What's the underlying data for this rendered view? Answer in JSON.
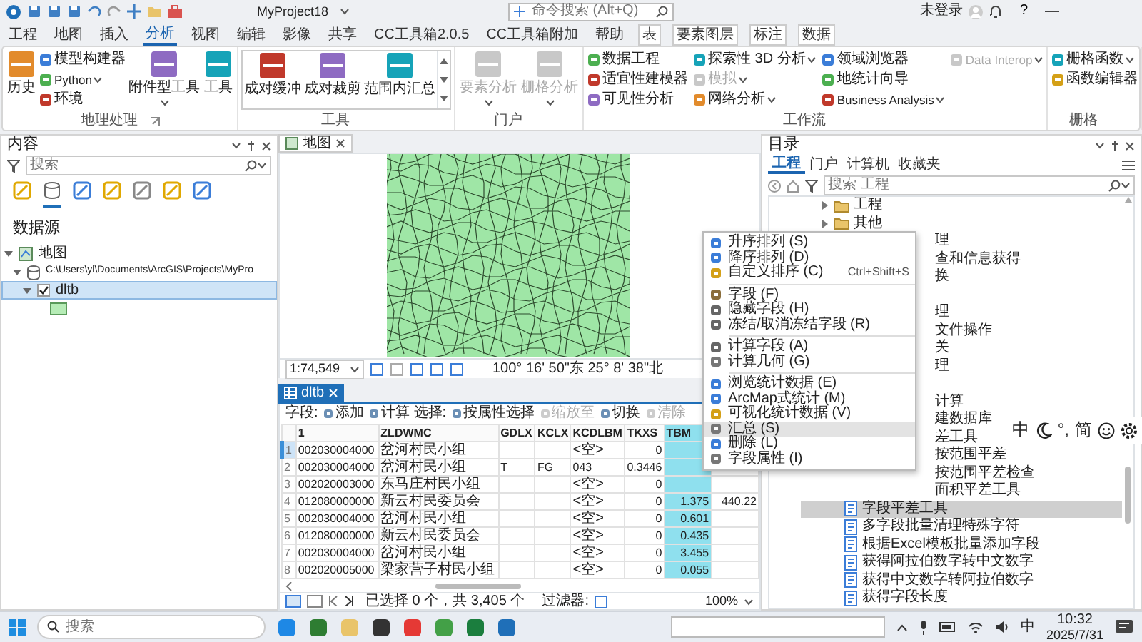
{
  "title_bar": {
    "project": "MyProject18",
    "search": {
      "placeholder": "命令搜索 (Alt+Q)"
    },
    "user": "未登录",
    "help": "?"
  },
  "ribbon_tabs": [
    {
      "label": "工程",
      "selected": false,
      "contextual": false
    },
    {
      "label": "地图",
      "selected": false,
      "contextual": false
    },
    {
      "label": "插入",
      "selected": false,
      "contextual": false
    },
    {
      "label": "分析",
      "selected": true,
      "contextual": false
    },
    {
      "label": "视图",
      "selected": false,
      "contextual": false
    },
    {
      "label": "编辑",
      "selected": false,
      "contextual": false
    },
    {
      "label": "影像",
      "selected": false,
      "contextual": false
    },
    {
      "label": "共享",
      "selected": false,
      "contextual": false
    },
    {
      "label": "CC工具箱2.0.5",
      "selected": false,
      "contextual": false
    },
    {
      "label": "CC工具箱附加",
      "selected": false,
      "contextual": false
    },
    {
      "label": "帮助",
      "selected": false,
      "contextual": false
    },
    {
      "label": "表",
      "selected": false,
      "contextual": true
    },
    {
      "label": "要素图层",
      "selected": false,
      "contextual": true
    },
    {
      "label": "标注",
      "selected": false,
      "contextual": true
    },
    {
      "label": "数据",
      "selected": false,
      "contextual": true
    }
  ],
  "ribbon_groups": [
    {
      "label": "地理处理",
      "launcher": true,
      "items": [
        {
          "label": "历史",
          "kind": "large",
          "dropdown": false,
          "disabled": false
        },
        {
          "label": "模型构建器",
          "kind": "small",
          "dropdown": false,
          "disabled": false
        },
        {
          "label": "Python",
          "kind": "small",
          "dropdown": true,
          "disabled": false
        },
        {
          "label": "环境",
          "kind": "small",
          "dropdown": false,
          "disabled": false
        },
        {
          "label": "附件型工具",
          "kind": "large",
          "dropdown": true,
          "disabled": false
        },
        {
          "label": "工具",
          "kind": "large",
          "dropdown": false,
          "disabled": false
        }
      ]
    },
    {
      "label": "工具",
      "launcher": false,
      "items": [
        {
          "label": "成对缓冲",
          "kind": "gallery",
          "dropdown": false,
          "disabled": false
        },
        {
          "label": "成对裁剪",
          "kind": "gallery",
          "dropdown": false,
          "disabled": false
        },
        {
          "label": "范围内汇总",
          "kind": "gallery",
          "dropdown": false,
          "disabled": false
        }
      ]
    },
    {
      "label": "门户",
      "launcher": false,
      "items": [
        {
          "label": "要素分析",
          "kind": "large",
          "dropdown": true,
          "disabled": true
        },
        {
          "label": "栅格分析",
          "kind": "large",
          "dropdown": true,
          "disabled": true
        }
      ]
    },
    {
      "label": "工作流",
      "launcher": false,
      "items": [
        {
          "label": "数据工程",
          "kind": "small",
          "dropdown": false,
          "disabled": false
        },
        {
          "label": "适宜性建模器",
          "kind": "small",
          "dropdown": false,
          "disabled": false
        },
        {
          "label": "可见性分析",
          "kind": "small",
          "dropdown": false,
          "disabled": false
        },
        {
          "label": "探索性 3D 分析",
          "kind": "small",
          "dropdown": true,
          "disabled": false
        },
        {
          "label": "模拟",
          "kind": "small",
          "dropdown": true,
          "disabled": true
        },
        {
          "label": "网络分析",
          "kind": "small",
          "dropdown": true,
          "disabled": false
        },
        {
          "label": "领域浏览器",
          "kind": "small",
          "dropdown": false,
          "disabled": false
        },
        {
          "label": "地统计向导",
          "kind": "small",
          "dropdown": false,
          "disabled": false
        },
        {
          "label": "Business Analysis",
          "kind": "small",
          "dropdown": true,
          "disabled": false
        },
        {
          "label": "Data Interop",
          "kind": "small",
          "dropdown": true,
          "disabled": true
        }
      ]
    },
    {
      "label": "栅格",
      "launcher": false,
      "items": [
        {
          "label": "栅格函数",
          "kind": "small",
          "dropdown": true,
          "disabled": false
        },
        {
          "label": "函数编辑器",
          "kind": "small",
          "dropdown": false,
          "disabled": false
        }
      ]
    }
  ],
  "contents_pane": {
    "title": "内容",
    "search": {
      "placeholder": "搜索"
    },
    "toolbar": [
      {
        "selected": false
      },
      {
        "selected": true
      },
      {
        "selected": false
      },
      {
        "selected": false
      },
      {
        "selected": false
      },
      {
        "selected": false
      },
      {
        "selected": false
      }
    ],
    "heading": "数据源",
    "tree": [
      {
        "label": "地图",
        "kind": "map",
        "expanded": true,
        "selected": false,
        "children": [
          {
            "label": "C:\\Users\\yl\\Documents\\ArcGIS\\Projects\\MyPro—",
            "kind": "database",
            "expanded": true,
            "selected": false,
            "children": [
              {
                "label": "dltb",
                "expanded": true,
                "checked": true,
                "selected": true,
                "children": [
                  {
                    "kind": "symbol"
                  }
                ]
              }
            ]
          }
        ]
      }
    ]
  },
  "map_view": {
    "tab": "地图",
    "scale": "1:74,549",
    "coordinates": "100° 16' 50\"东 25° 8' 38\"北"
  },
  "table_view": {
    "tab": "dltb",
    "toolbar": [
      {
        "label": "字段:",
        "kind": "label"
      },
      {
        "label": "添加",
        "kind": "button",
        "disabled": false
      },
      {
        "label": "计算",
        "kind": "button",
        "disabled": false
      },
      {
        "label": "选择:",
        "kind": "label"
      },
      {
        "label": "按属性选择",
        "kind": "button",
        "disabled": false
      },
      {
        "label": "缩放至",
        "kind": "button",
        "disabled": true
      },
      {
        "label": "切换",
        "kind": "button",
        "disabled": false
      },
      {
        "label": "清除",
        "kind": "button",
        "disabled": true
      }
    ],
    "columns": [
      {
        "label": "1",
        "selected": false
      },
      {
        "label": "ZLDWMC",
        "selected": false
      },
      {
        "label": "GDLX",
        "selected": false
      },
      {
        "label": "KCLX",
        "selected": false
      },
      {
        "label": "KCDLBM",
        "selected": false
      },
      {
        "label": "TKXS",
        "selected": false
      },
      {
        "label": "TBM",
        "selected": true
      }
    ],
    "rows": [
      {
        "number": "1",
        "selected": true,
        "cells": [
          "002030004000",
          "岔河村民小组",
          null,
          null,
          "<空>",
          "0",
          null,
          null
        ]
      },
      {
        "number": "2",
        "selected": false,
        "cells": [
          "002030004000",
          "岔河村民小组",
          "T",
          "FG",
          "043",
          "0.3446",
          null,
          null
        ]
      },
      {
        "number": "3",
        "selected": false,
        "cells": [
          "002020003000",
          "东马庄村民小组",
          null,
          null,
          "<空>",
          "0",
          null,
          null
        ]
      },
      {
        "number": "4",
        "selected": false,
        "cells": [
          "012080000000",
          "新云村民委员会",
          null,
          null,
          "<空>",
          "0",
          "1.375",
          "440.22"
        ]
      },
      {
        "number": "5",
        "selected": false,
        "cells": [
          "002030004000",
          "岔河村民小组",
          null,
          null,
          "<空>",
          "0",
          "0.601",
          null
        ]
      },
      {
        "number": "6",
        "selected": false,
        "cells": [
          "012080000000",
          "新云村民委员会",
          null,
          null,
          "<空>",
          "0",
          "0.435",
          null
        ]
      },
      {
        "number": "7",
        "selected": false,
        "cells": [
          "002030004000",
          "岔河村民小组",
          null,
          null,
          "<空>",
          "0",
          "3.455",
          null
        ]
      },
      {
        "number": "8",
        "selected": false,
        "cells": [
          "002020005000",
          "梁家营子村民小组",
          null,
          null,
          "<空>",
          "0",
          "0.055",
          null
        ]
      }
    ],
    "status": "已选择 0 个，共 3,405 个",
    "filter_label": "过滤器:",
    "zoom": "100%"
  },
  "context_menu": [
    {
      "kind": "item",
      "label": "升序排列 (S)",
      "highlighted": false
    },
    {
      "kind": "item",
      "label": "降序排列 (D)",
      "highlighted": false
    },
    {
      "kind": "item",
      "label": "自定义排序 (C)",
      "shortcut": "Ctrl+Shift+S",
      "highlighted": false
    },
    {
      "kind": "separator"
    },
    {
      "kind": "item",
      "label": "字段 (F)",
      "highlighted": false
    },
    {
      "kind": "item",
      "label": "隐藏字段 (H)",
      "highlighted": false
    },
    {
      "kind": "item",
      "label": "冻结/取消冻结字段 (R)",
      "highlighted": false
    },
    {
      "kind": "separator"
    },
    {
      "kind": "item",
      "label": "计算字段 (A)",
      "highlighted": false
    },
    {
      "kind": "item",
      "label": "计算几何 (G)",
      "highlighted": false
    },
    {
      "kind": "separator"
    },
    {
      "kind": "item",
      "label": "浏览统计数据 (E)",
      "highlighted": false
    },
    {
      "kind": "item",
      "label": "ArcMap式统计 (M)",
      "highlighted": false
    },
    {
      "kind": "item",
      "label": "可视化统计数据 (V)",
      "highlighted": false
    },
    {
      "kind": "item",
      "label": "汇总 (S)",
      "highlighted": true
    },
    {
      "kind": "item",
      "label": "删除 (L)",
      "highlighted": false
    },
    {
      "kind": "item",
      "label": "字段属性 (I)",
      "highlighted": false
    }
  ],
  "catalog_pane": {
    "title": "目录",
    "tabs": [
      {
        "label": "工程",
        "selected": true
      },
      {
        "label": "门户",
        "selected": false
      },
      {
        "label": "计算机",
        "selected": false
      },
      {
        "label": "收藏夹",
        "selected": false
      }
    ],
    "search": {
      "placeholder": "搜索 工程"
    },
    "tree": [
      {
        "label": "工程",
        "kind": "folder",
        "expanded": false,
        "selected": false
      },
      {
        "label": "其他",
        "kind": "folder",
        "expanded": false,
        "selected": false
      },
      {
        "label": "理",
        "kind": "partial",
        "selected": false
      },
      {
        "label": "查和信息获得",
        "kind": "partial",
        "selected": false
      },
      {
        "label": "换",
        "kind": "partial",
        "selected": false
      },
      {
        "kind": "covered"
      },
      {
        "label": "理",
        "kind": "partial",
        "selected": false
      },
      {
        "label": "文件操作",
        "kind": "partial",
        "selected": false
      },
      {
        "label": "关",
        "kind": "partial",
        "selected": false
      },
      {
        "label": "理",
        "kind": "partial",
        "selected": false
      },
      {
        "kind": "covered"
      },
      {
        "label": "计算",
        "kind": "partial",
        "selected": false
      },
      {
        "label": "建数据库",
        "kind": "partial",
        "selected": false
      },
      {
        "label": "差工具",
        "kind": "partial",
        "selected": false
      },
      {
        "label": "按范围平差",
        "kind": "partial",
        "selected": false
      },
      {
        "label": "按范围平差检查",
        "kind": "partial",
        "selected": false
      },
      {
        "label": "面积平差工具",
        "kind": "partial",
        "selected": false
      },
      {
        "label": "字段平差工具",
        "kind": "script",
        "selected": true
      },
      {
        "label": "多字段批量清理特殊字符",
        "kind": "script",
        "selected": false
      },
      {
        "label": "根据Excel模板批量添加字段",
        "kind": "script",
        "selected": false
      },
      {
        "label": "获得阿拉伯数字转中文数字",
        "kind": "script",
        "selected": false
      },
      {
        "label": "获得中文数字转阿拉伯数字",
        "kind": "script",
        "selected": false
      },
      {
        "label": "获得字段长度",
        "kind": "script",
        "selected": false
      }
    ]
  },
  "ime_toolbar": [
    {
      "kind": "text",
      "label": "中"
    },
    {
      "kind": "moon"
    },
    {
      "kind": "text",
      "label": "°,"
    },
    {
      "kind": "text",
      "label": "简"
    },
    {
      "kind": "smiley"
    },
    {
      "kind": "gear"
    }
  ],
  "taskbar": {
    "search": {
      "placeholder": "搜索"
    },
    "input_method": "中",
    "time": "10:32",
    "date": "2025/7/31"
  }
}
